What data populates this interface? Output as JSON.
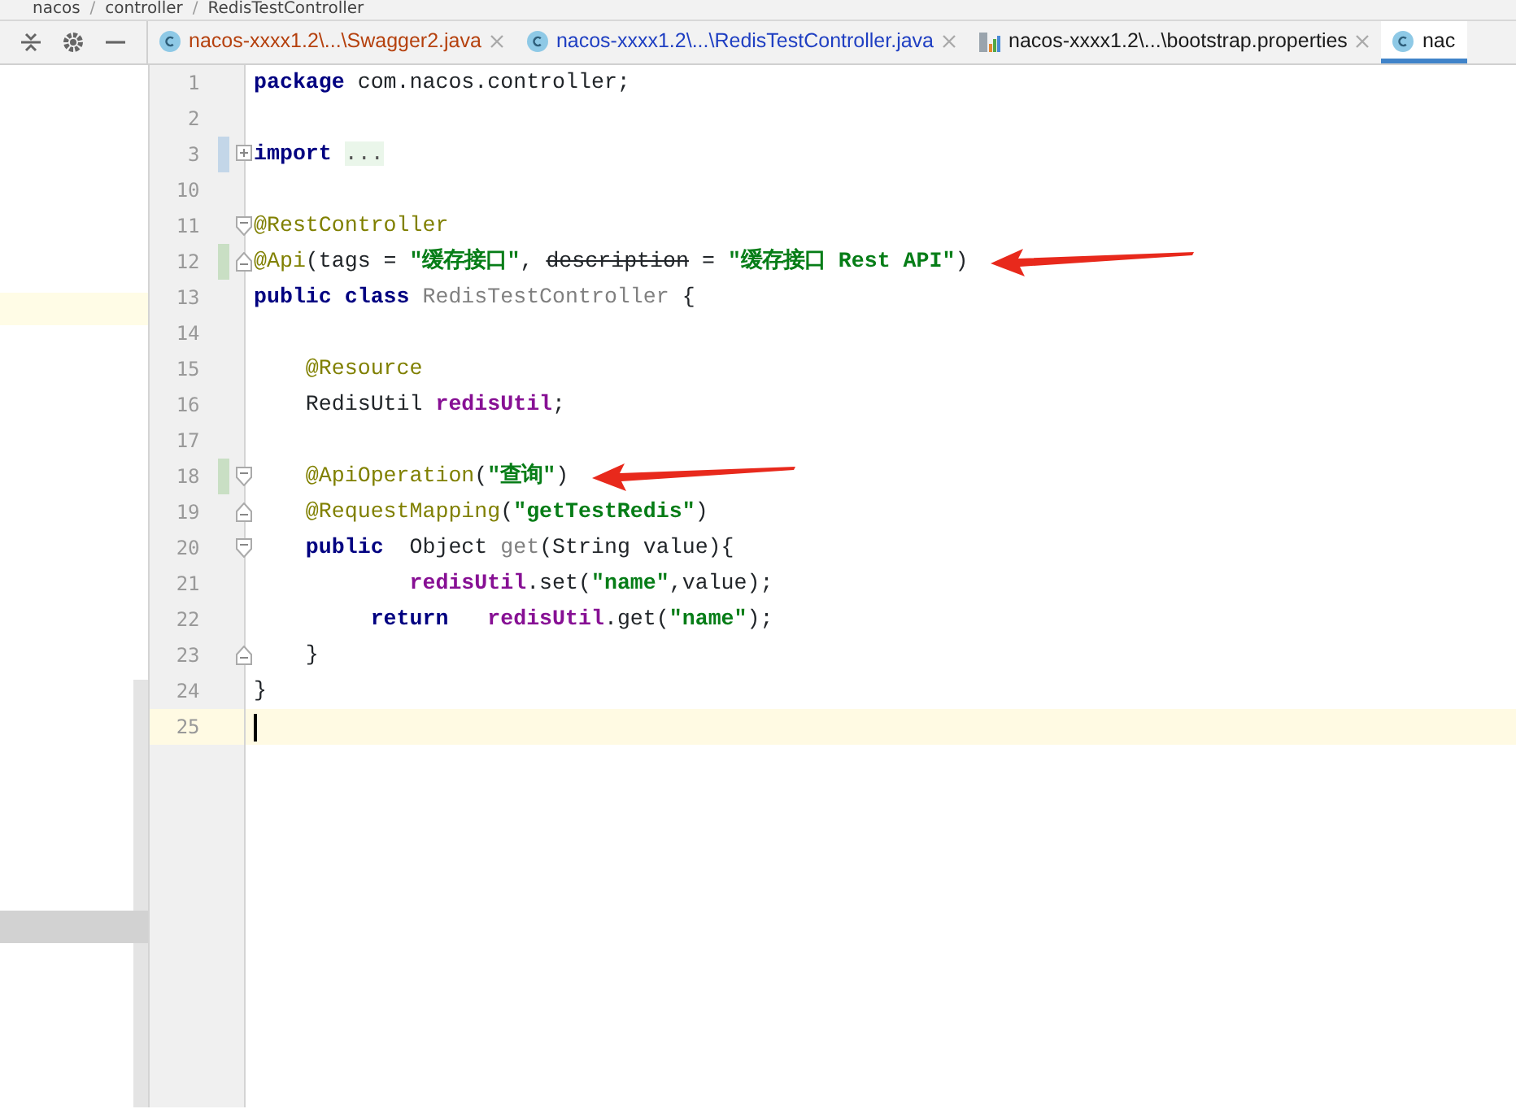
{
  "breadcrumb": {
    "separator": "/",
    "items": [
      "nacos",
      "controller",
      "RedisTestController"
    ]
  },
  "tabs": [
    {
      "label": "nacos-xxxx1.2\\...\\Swagger2.java",
      "kind": "class",
      "color": "#b5410e",
      "selected": false
    },
    {
      "label": "nacos-xxxx1.2\\...\\RedisTestController.java",
      "kind": "class",
      "color": "#1f3fc2",
      "selected": false
    },
    {
      "label": "nacos-xxxx1.2\\...\\bootstrap.properties",
      "kind": "properties",
      "color": "#1a1a1a",
      "selected": false
    },
    {
      "label": "nac",
      "kind": "class",
      "color": "#1a1a1a",
      "selected": true
    }
  ],
  "lines": [
    {
      "number": "1",
      "tokens": [
        {
          "kind": "keyword",
          "text": "package"
        },
        {
          "kind": "plain",
          "text": " com.nacos.controller;"
        }
      ]
    },
    {
      "number": "2"
    },
    {
      "number": "3",
      "color": "#c3d6e8",
      "collapsed": true,
      "tokens": [
        {
          "kind": "keyword",
          "text": "import "
        },
        {
          "kind": "folded",
          "text": "..."
        }
      ]
    },
    {
      "number": "10"
    },
    {
      "number": "11",
      "fold_start": true,
      "tokens": [
        {
          "kind": "annotation",
          "text": "@RestController"
        }
      ]
    },
    {
      "number": "12",
      "color": "#c9dfc4",
      "fold_end": true,
      "arrow": true,
      "tokens": [
        {
          "kind": "annotation",
          "text": "@Api"
        },
        {
          "kind": "plain",
          "text": "(tags = "
        },
        {
          "kind": "string",
          "text": "\"缓存接口\""
        },
        {
          "kind": "plain",
          "text": ", "
        },
        {
          "kind": "deprecated",
          "text": "description"
        },
        {
          "kind": "plain",
          "text": " = "
        },
        {
          "kind": "string",
          "text": "\"缓存接口 Rest API\""
        },
        {
          "kind": "plain",
          "text": ")"
        }
      ]
    },
    {
      "number": "13",
      "tokens": [
        {
          "kind": "keyword",
          "text": "public class "
        },
        {
          "kind": "unused",
          "text": "RedisTestController"
        },
        {
          "kind": "plain",
          "text": " {"
        }
      ]
    },
    {
      "number": "14"
    },
    {
      "number": "15",
      "tokens": [
        {
          "kind": "annotation",
          "text": "    @Resource"
        }
      ]
    },
    {
      "number": "16",
      "tokens": [
        {
          "kind": "plain",
          "text": "    RedisUtil "
        },
        {
          "kind": "field",
          "text": "redisUtil"
        },
        {
          "kind": "plain",
          "text": ";"
        }
      ]
    },
    {
      "number": "17"
    },
    {
      "number": "18",
      "color": "#c9dfc4",
      "fold_start": true,
      "arrow": true,
      "tokens": [
        {
          "kind": "annotation",
          "text": "    @ApiOperation"
        },
        {
          "kind": "plain",
          "text": "("
        },
        {
          "kind": "string",
          "text": "\"查询\""
        },
        {
          "kind": "plain",
          "text": ")"
        }
      ]
    },
    {
      "number": "19",
      "fold_end": true,
      "tokens": [
        {
          "kind": "annotation",
          "text": "    @RequestMapping"
        },
        {
          "kind": "plain",
          "text": "("
        },
        {
          "kind": "string",
          "text": "\"getTestRedis\""
        },
        {
          "kind": "plain",
          "text": ")"
        }
      ]
    },
    {
      "number": "20",
      "fold_start": true,
      "tokens": [
        {
          "kind": "keyword",
          "text": "    public"
        },
        {
          "kind": "plain",
          "text": "  Object "
        },
        {
          "kind": "unused",
          "text": "get"
        },
        {
          "kind": "plain",
          "text": "(String value){"
        }
      ]
    },
    {
      "number": "21",
      "tokens": [
        {
          "kind": "field",
          "text": "            redisUtil"
        },
        {
          "kind": "plain",
          "text": ".set("
        },
        {
          "kind": "string",
          "text": "\"name\""
        },
        {
          "kind": "plain",
          "text": ",value);"
        }
      ]
    },
    {
      "number": "22",
      "tokens": [
        {
          "kind": "keyword",
          "text": "         return   "
        },
        {
          "kind": "field",
          "text": "redisUtil"
        },
        {
          "kind": "plain",
          "text": ".get("
        },
        {
          "kind": "string",
          "text": "\"name\""
        },
        {
          "kind": "plain",
          "text": ");"
        }
      ]
    },
    {
      "number": "23",
      "fold_end": true,
      "tokens": [
        {
          "kind": "plain",
          "text": "    }"
        }
      ]
    },
    {
      "number": "24",
      "tokens": [
        {
          "kind": "plain",
          "text": "}"
        }
      ]
    },
    {
      "number": "25",
      "current": true
    }
  ]
}
